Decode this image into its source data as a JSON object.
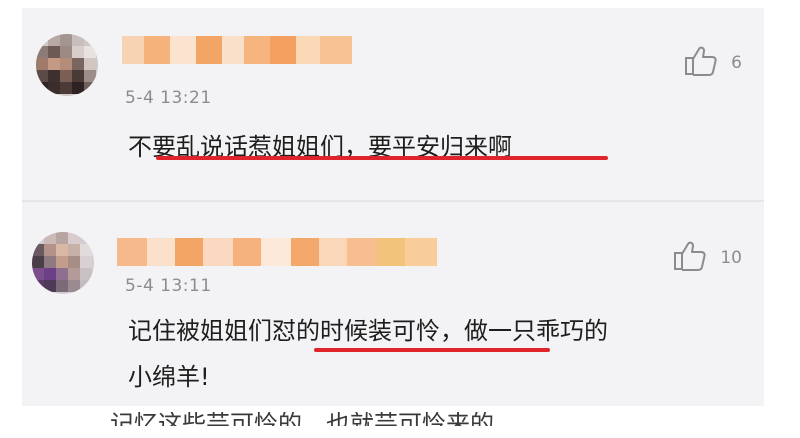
{
  "comments": [
    {
      "time": "5-4  13:21",
      "likes": "6",
      "text": "不要乱说话惹姐姐们，要平安归来啊",
      "like_icon": "thumbs-up-icon"
    },
    {
      "time": "5-4  13:11",
      "likes": "10",
      "text_line1": "记住被姐姐们怼的时候装可怜，做一只乖巧的",
      "text_line2": "小绵羊!",
      "like_icon": "thumbs-up-icon"
    }
  ],
  "colors": {
    "background": "#f3f3f5",
    "underline": "#e0242b",
    "meta_text": "#8c8c8c",
    "blur_orange": "#f3a565",
    "blur_peach": "#f7c9a4"
  },
  "bottom_text": "记忆这些芸可怜的，也就芸可怜来的"
}
